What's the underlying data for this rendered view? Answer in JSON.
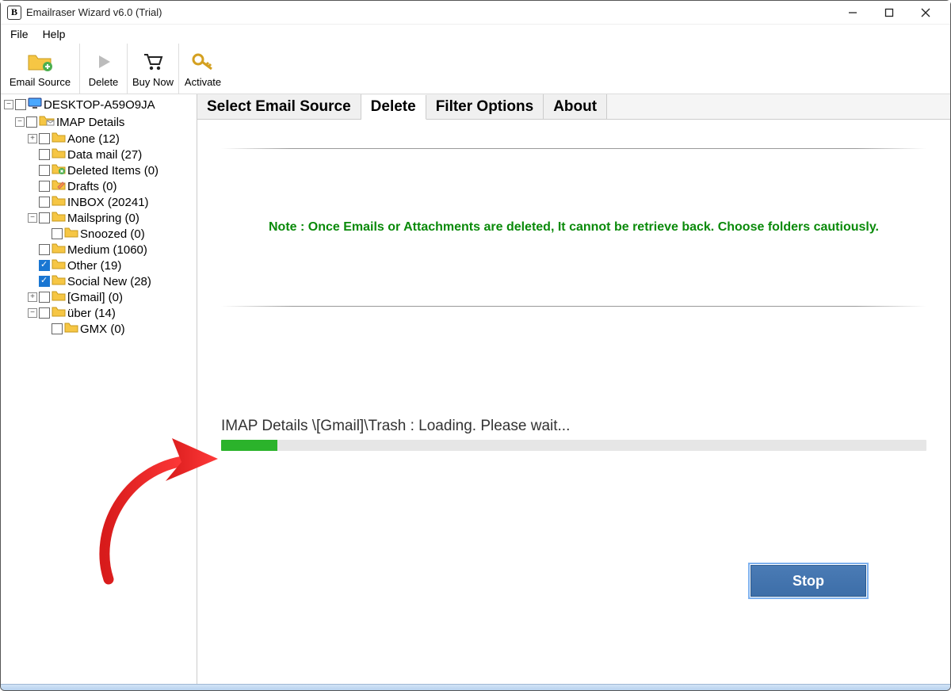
{
  "window": {
    "title": "Emailraser Wizard v6.0 (Trial)",
    "app_icon_letter": "B"
  },
  "menu": {
    "file": "File",
    "help": "Help"
  },
  "toolbar": {
    "email_source": "Email Source",
    "delete": "Delete",
    "buy_now": "Buy Now",
    "activate": "Activate"
  },
  "tabs": {
    "select_source": "Select Email Source",
    "delete": "Delete",
    "filter": "Filter Options",
    "about": "About"
  },
  "content": {
    "note": "Note : Once Emails or Attachments are deleted, It cannot be retrieve back. Choose folders cautiously.",
    "status": "IMAP Details \\[Gmail]\\Trash : Loading. Please wait...",
    "stop_label": "Stop",
    "progress_percent": 8
  },
  "tree": [
    {
      "ind": 0,
      "pm": "-",
      "cb": false,
      "icon": "monitor",
      "label": "DESKTOP-A59O9JA"
    },
    {
      "ind": 1,
      "pm": "-",
      "cb": false,
      "icon": "imap",
      "label": "IMAP Details"
    },
    {
      "ind": 2,
      "pm": "+",
      "cb": false,
      "icon": "folder",
      "label": "Aone (12)"
    },
    {
      "ind": 2,
      "pm": "",
      "cb": false,
      "icon": "folder",
      "label": "Data mail (27)"
    },
    {
      "ind": 2,
      "pm": "",
      "cb": false,
      "icon": "trash",
      "label": "Deleted Items (0)"
    },
    {
      "ind": 2,
      "pm": "",
      "cb": false,
      "icon": "draft",
      "label": "Drafts (0)"
    },
    {
      "ind": 2,
      "pm": "",
      "cb": false,
      "icon": "folder",
      "label": "INBOX (20241)"
    },
    {
      "ind": 2,
      "pm": "-",
      "cb": false,
      "icon": "folder",
      "label": "Mailspring (0)"
    },
    {
      "ind": 3,
      "pm": "",
      "cb": false,
      "icon": "folder",
      "label": "Snoozed (0)"
    },
    {
      "ind": 2,
      "pm": "",
      "cb": false,
      "icon": "folder",
      "label": "Medium (1060)"
    },
    {
      "ind": 2,
      "pm": "",
      "cb": true,
      "icon": "folder",
      "label": "Other (19)"
    },
    {
      "ind": 2,
      "pm": "",
      "cb": true,
      "icon": "folder",
      "label": "Social New (28)"
    },
    {
      "ind": 2,
      "pm": "+",
      "cb": false,
      "icon": "folder",
      "label": "[Gmail] (0)"
    },
    {
      "ind": 2,
      "pm": "-",
      "cb": false,
      "icon": "folder",
      "label": "über (14)"
    },
    {
      "ind": 3,
      "pm": "",
      "cb": false,
      "icon": "folder",
      "label": "GMX (0)"
    }
  ]
}
